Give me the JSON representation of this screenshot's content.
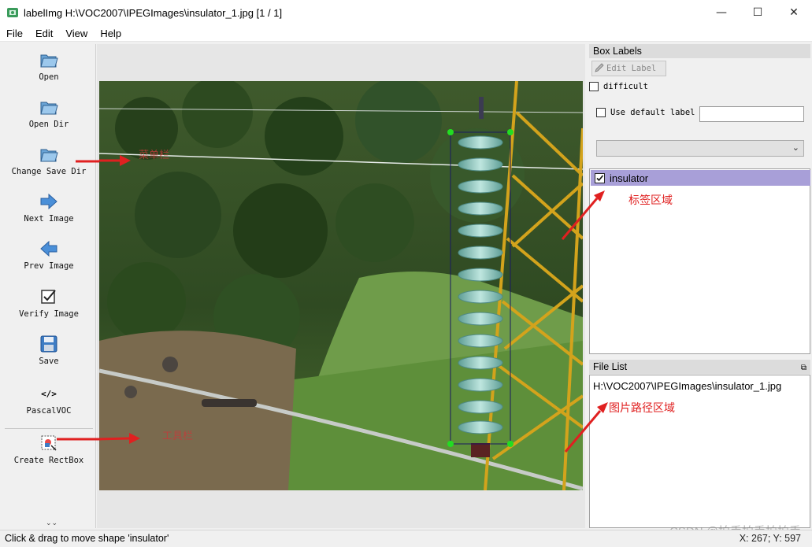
{
  "window": {
    "title": "labelImg H:\\VOC2007\\IPEGImages\\insulator_1.jpg [1 / 1]",
    "controls": {
      "minimize": "—",
      "maximize": "☐",
      "close": "✕"
    }
  },
  "menu": [
    "File",
    "Edit",
    "View",
    "Help"
  ],
  "toolbar": {
    "open": "Open",
    "open_dir": "Open Dir",
    "change_save_dir": "Change Save Dir",
    "next_image": "Next Image",
    "prev_image": "Prev Image",
    "verify_image": "Verify Image",
    "save": "Save",
    "format": "PascalVOC",
    "format_icon": "</>",
    "create_rectbox": "Create RectBox",
    "more": "⌄⌄"
  },
  "box_labels": {
    "title": "Box Labels",
    "edit_label": "Edit Label",
    "difficult": "difficult",
    "use_default_label": "Use default label",
    "default_label_value": "",
    "labels": [
      {
        "name": "insulator",
        "checked": true
      }
    ]
  },
  "file_list": {
    "title": "File List",
    "files": [
      "H:\\VOC2007\\IPEGImages\\insulator_1.jpg"
    ]
  },
  "annotations": {
    "label_area": "标签区域",
    "path_area": "图片路径区域",
    "menu_bar_note": "菜单栏",
    "bottom_note": "工具栏"
  },
  "status": {
    "message": "Click & drag to move shape 'insulator'",
    "coords": "X: 267; Y: 597"
  },
  "watermark": "CSDN @拍手拍手拍拍手",
  "colors": {
    "selected_label_bg": "#a89fd8",
    "annotation_red": "#e02020",
    "bbox_corner": "#22dd22"
  }
}
